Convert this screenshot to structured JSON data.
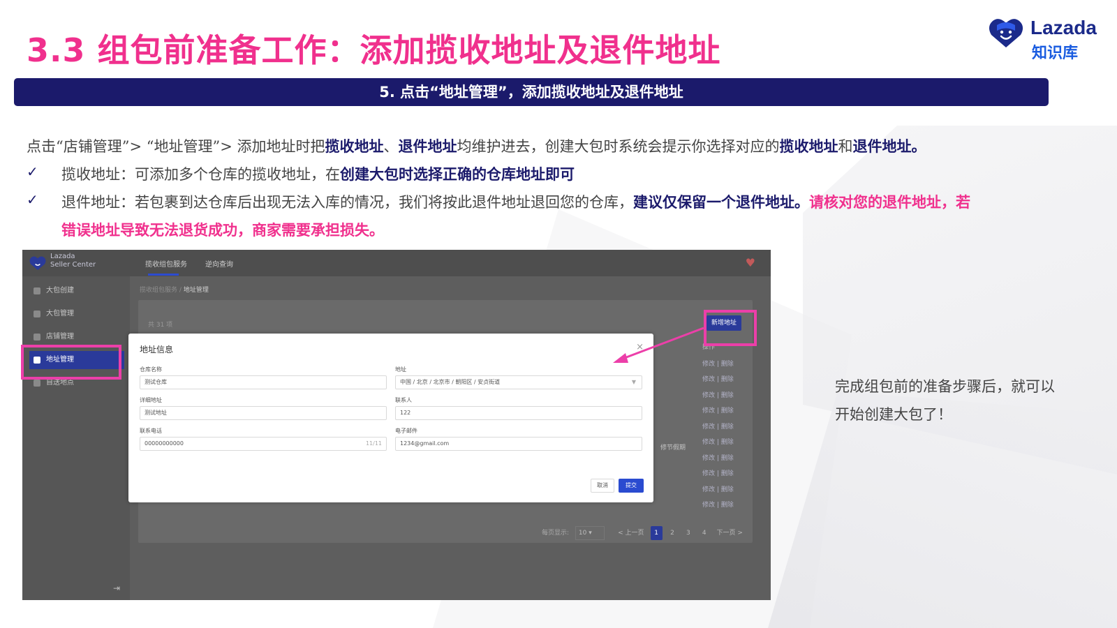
{
  "title": "3.3 组包前准备工作：添加揽收地址及退件地址",
  "logo": {
    "name": "Lazada",
    "sub": "知识库"
  },
  "banner": "5. 点击“地址管理”，添加揽收地址及退件地址",
  "intro": {
    "t1": "点击“店铺管理”> “地址管理”> 添加地址时把",
    "b1": "揽收地址",
    "t2": "、",
    "b2": "退件地址",
    "t3": "均维护进去，创建大包时系统会提示你选择对应的",
    "b3": "揽收地址",
    "t4": "和",
    "b4": "退件地址。"
  },
  "check_mark": "✓",
  "pickup": {
    "t1": "揽收地址：可添加多个仓库的揽收地址，在",
    "b1": "创建大包时选择正确的仓库地址即可"
  },
  "returns": {
    "t1": "退件地址：若包裹到达仓库后出现无法入库的情况，我们将按此退件地址退回您的仓库，",
    "b1": "建议仅保留一个退件地址。",
    "p1": "请核对您的退件地址，若",
    "p2": "错误地址导致无法退货成功，商家需要承担损失。"
  },
  "side_note": {
    "line1": "完成组包前的准备步骤后，就可以",
    "line2": "开始创建大包了！"
  },
  "colors": {
    "title": "#f0308d",
    "banner": "#1b1a6b",
    "highlight": "#ec3fa9",
    "primary": "#2a4bd0"
  },
  "screenshot": {
    "brand": {
      "line1": "Lazada",
      "line2": "Seller Center"
    },
    "tabs": [
      "揽收组包服务",
      "逆向查询"
    ],
    "sidebar": [
      {
        "label": "大包创建",
        "icon": "box-icon"
      },
      {
        "label": "大包管理",
        "icon": "package-icon"
      },
      {
        "label": "店铺管理",
        "icon": "store-icon"
      },
      {
        "label": "地址管理",
        "icon": "address-icon",
        "active": true
      },
      {
        "label": "自送地点",
        "icon": "location-icon"
      }
    ],
    "breadcrumb": {
      "parent": "揽收组包服务",
      "sep": "/",
      "current": "地址管理"
    },
    "total": "共 31 项",
    "add_button": "新增地址",
    "ops_header": "操作",
    "ops_row": "修改 | 删除",
    "extra_cell": "修节假期",
    "pager": {
      "size_label": "每页显示:",
      "size": "10",
      "prev": "< 上一页",
      "pages": [
        "1",
        "2",
        "3",
        "4"
      ],
      "next": "下一页 >"
    },
    "modal": {
      "title": "地址信息",
      "close": "×",
      "fields": {
        "warehouse_label": "仓库名称",
        "warehouse_value": "测试仓库",
        "address_label": "地址",
        "address_value": "中国 / 北京 / 北京市 / 朝阳区 / 安贞街道",
        "detail_label": "详细地址",
        "detail_value": "测试地址",
        "contact_label": "联系人",
        "contact_value": "122",
        "phone_label": "联系电话",
        "phone_value": "00000000000",
        "phone_count": "11/11",
        "email_label": "电子邮件",
        "email_value": "1234@gmail.com"
      },
      "cancel": "取消",
      "submit": "提交"
    }
  }
}
